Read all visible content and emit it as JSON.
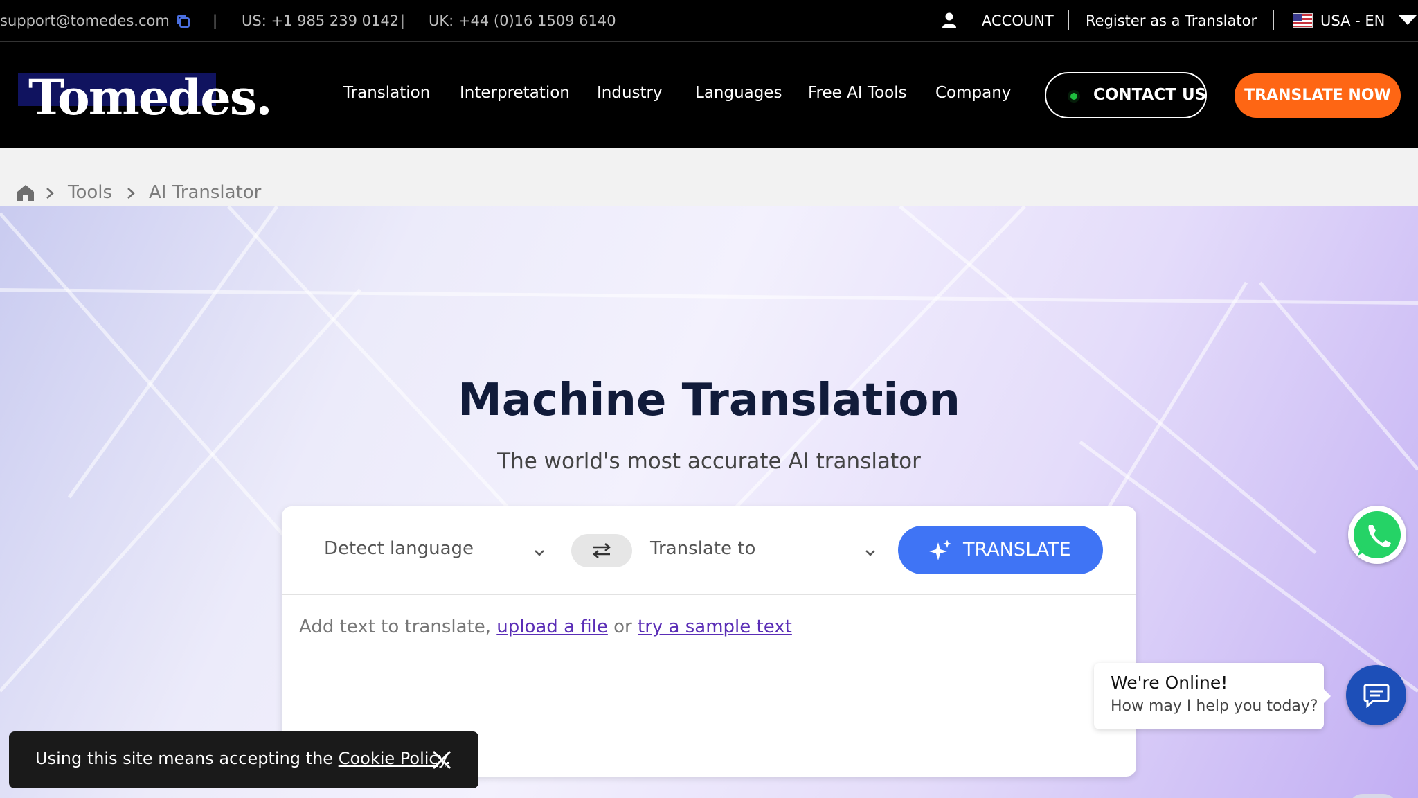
{
  "topbar": {
    "email": "support@tomedes.com",
    "separator": "|",
    "us_phone": "US: +1 985 239 0142",
    "uk_phone": "UK: +44 (0)16 1509 6140",
    "account": "ACCOUNT",
    "register": "Register as a Translator",
    "locale": "USA - EN"
  },
  "nav": {
    "logo": "Tomedes.",
    "items": [
      "Translation",
      "Interpretation",
      "Industry",
      "Languages",
      "Free AI Tools",
      "Company"
    ],
    "contact": "CONTACT US",
    "translate_now": "TRANSLATE NOW"
  },
  "breadcrumb": {
    "items": [
      "Tools",
      "AI Translator"
    ]
  },
  "hero": {
    "title": "Machine Translation",
    "subtitle": "The world's most accurate AI translator"
  },
  "translator": {
    "source_lang": "Detect language",
    "target_lang": "Translate to",
    "translate_button": "TRANSLATE",
    "input_prefix": "Add text to translate,",
    "upload_link": "upload a file",
    "or_text": "or",
    "sample_link": "try a sample text"
  },
  "chat": {
    "title": "We're Online!",
    "subtitle": "How may I help you today?"
  },
  "cookie": {
    "text": "Using this site means accepting the",
    "link": "Cookie Policy",
    "period": "."
  },
  "colors": {
    "accent_orange": "#fe6614",
    "translate_blue": "#3f74f5",
    "logo_navy": "#10135f",
    "chat_blue": "#1d4fb8",
    "link_purple": "#5a2db6"
  }
}
